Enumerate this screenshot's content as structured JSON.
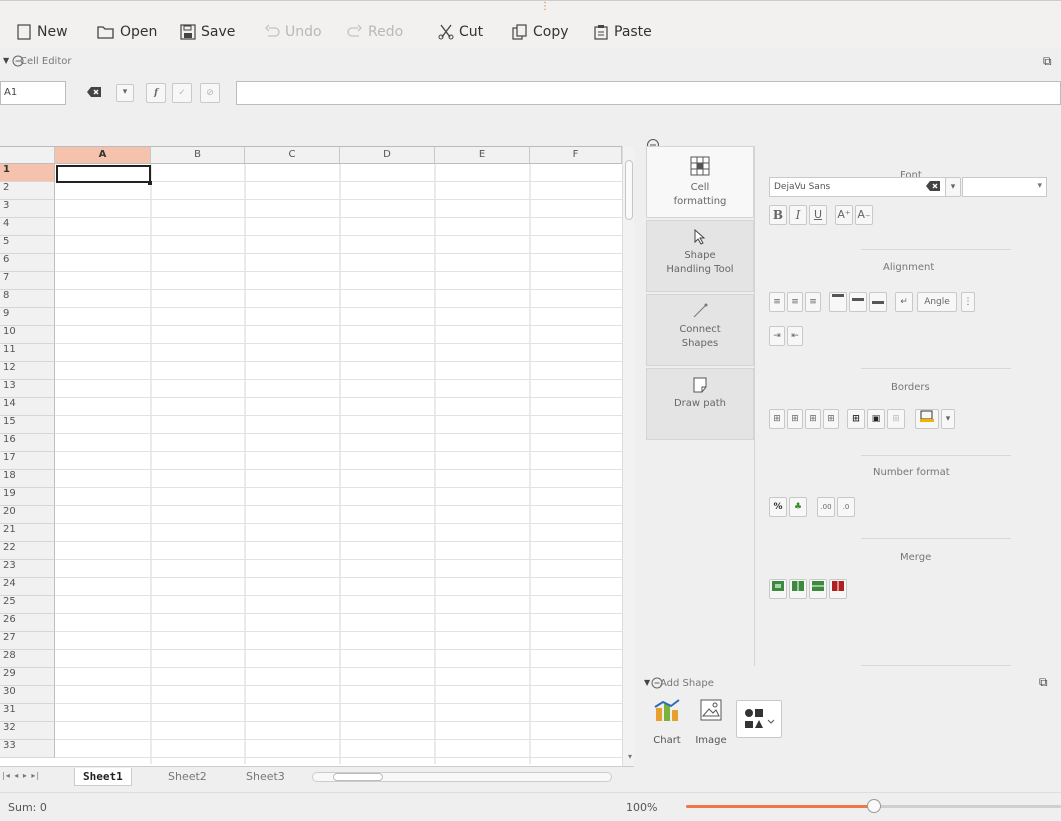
{
  "toolbar": {
    "new_label": "New",
    "open_label": "Open",
    "save_label": "Save",
    "undo_label": "Undo",
    "redo_label": "Redo",
    "cut_label": "Cut",
    "copy_label": "Copy",
    "paste_label": "Paste"
  },
  "cell_editor": {
    "title": "Cell Editor",
    "cell_reference": "A1",
    "formula": ""
  },
  "sheet": {
    "columns": [
      "A",
      "B",
      "C",
      "D",
      "E",
      "F"
    ],
    "selected_column": "A",
    "rows": [
      "1",
      "2",
      "3",
      "4",
      "5",
      "6",
      "7",
      "8",
      "9",
      "10",
      "11",
      "12",
      "13",
      "14",
      "15",
      "16",
      "17",
      "18",
      "19",
      "20",
      "21",
      "22",
      "23",
      "24",
      "25",
      "26",
      "27",
      "28",
      "29",
      "30",
      "31",
      "32",
      "33"
    ],
    "selected_row": "1",
    "selected_cell": "A1"
  },
  "sheet_tabs": {
    "tabs": [
      "Sheet1",
      "Sheet2",
      "Sheet3"
    ],
    "active_tab": "Sheet1"
  },
  "tool_tabs": [
    {
      "label_line1": "Cell",
      "label_line2": "formatting",
      "icon": "grid-icon"
    },
    {
      "label_line1": "Shape",
      "label_line2": "Handling Tool",
      "icon": "cursor-arrow-icon"
    },
    {
      "label_line1": "Connect",
      "label_line2": "Shapes",
      "icon": "connector-line-icon"
    },
    {
      "label_line1": "Draw path",
      "label_line2": "",
      "icon": "path-page-icon"
    }
  ],
  "cell_formatting": {
    "font_title": "Font",
    "font_family": "DejaVu Sans",
    "font_size": "",
    "alignment_title": "Alignment",
    "angle_label": "Angle",
    "borders_title": "Borders",
    "number_format_title": "Number format",
    "merge_title": "Merge"
  },
  "add_shape": {
    "title": "Add Shape",
    "chart_label": "Chart",
    "image_label": "Image"
  },
  "status": {
    "sum_text": "Sum: 0",
    "zoom_text": "100%",
    "zoom_fraction": 0.5
  },
  "colors": {
    "selection_header": "#f5c2ad",
    "zoom_accent": "#f07746"
  }
}
